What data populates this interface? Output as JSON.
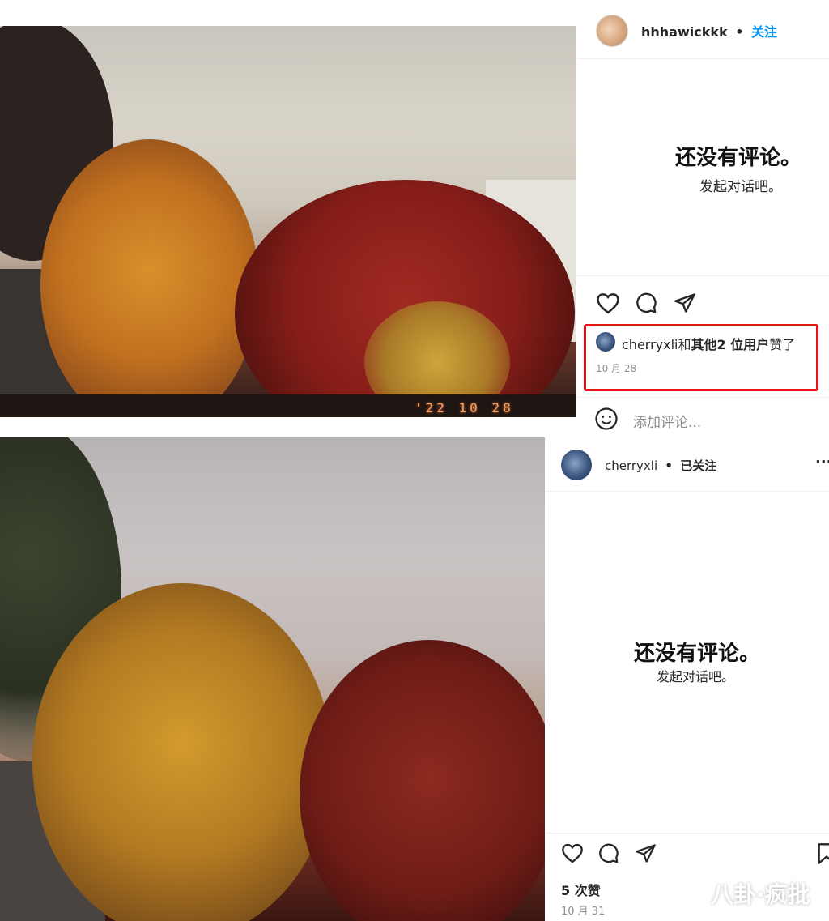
{
  "top_post": {
    "username": "hhhawickkk",
    "separator": "•",
    "follow_label": "关注",
    "empty_title": "还没有评论。",
    "empty_sub": "发起对话吧。",
    "liked_by_user": "cherryxli",
    "liked_by_and": "和",
    "liked_by_others": "其他2 位用户",
    "liked_by_suffix": "赞了",
    "date": "10 月 28",
    "comment_placeholder": "添加评论...",
    "photo_stamp": "'22 10 28"
  },
  "bottom_post": {
    "username": "cherryxli",
    "separator": "•",
    "follow_label": "已关注",
    "more": "···",
    "empty_title": "还没有评论。",
    "empty_sub": "发起对话吧。",
    "likes": "5 次赞",
    "date": "10 月 31"
  },
  "watermark": "八卦·疯批",
  "colors": {
    "highlight_box": "#e4141b",
    "follow_blue": "#0095f6"
  }
}
